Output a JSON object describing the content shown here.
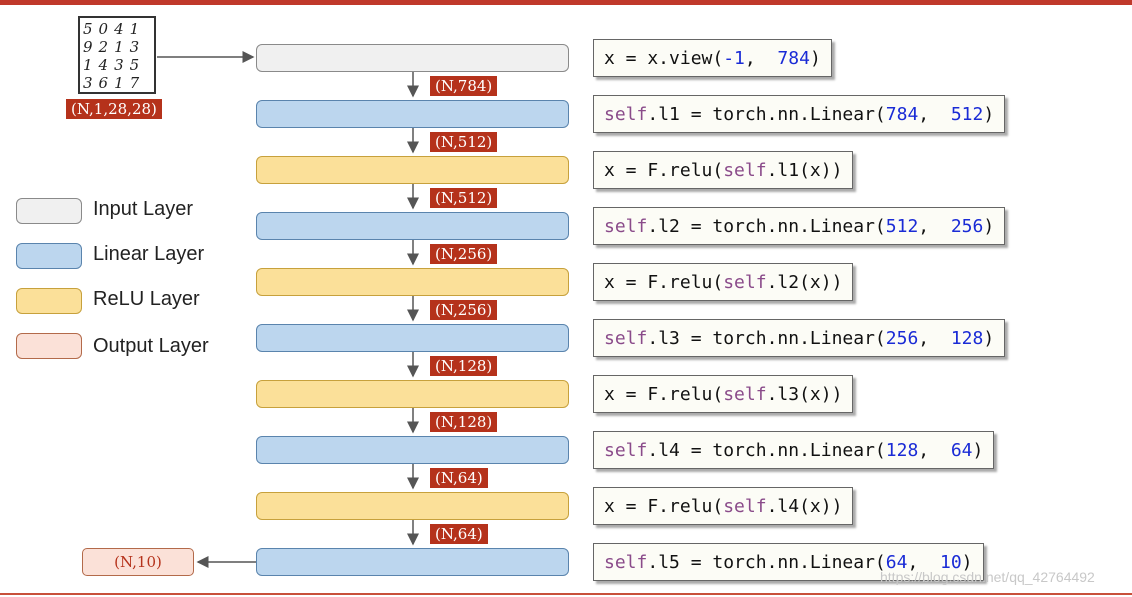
{
  "mnist": {
    "rows": [
      "5041",
      "9213",
      "1435",
      "3617"
    ]
  },
  "input_shape": "(N,1,28,28)",
  "shapes": [
    "(N,784)",
    "(N,512)",
    "(N,512)",
    "(N,256)",
    "(N,256)",
    "(N,128)",
    "(N,128)",
    "(N,64)",
    "(N,64)"
  ],
  "output_shape": "(N,10)",
  "code_lines": [
    [
      {
        "t": "x = x.view("
      },
      {
        "t": "-1",
        "c": "num"
      },
      {
        "t": ",  "
      },
      {
        "t": "784",
        "c": "num"
      },
      {
        "t": ")"
      }
    ],
    [
      {
        "t": "self",
        "c": "kw"
      },
      {
        "t": ".l1 = torch.nn.Linear("
      },
      {
        "t": "784",
        "c": "num"
      },
      {
        "t": ",  "
      },
      {
        "t": "512",
        "c": "num"
      },
      {
        "t": ")"
      }
    ],
    [
      {
        "t": "x = F.relu("
      },
      {
        "t": "self",
        "c": "kw"
      },
      {
        "t": ".l1(x))"
      }
    ],
    [
      {
        "t": "self",
        "c": "kw"
      },
      {
        "t": ".l2 = torch.nn.Linear("
      },
      {
        "t": "512",
        "c": "num"
      },
      {
        "t": ",  "
      },
      {
        "t": "256",
        "c": "num"
      },
      {
        "t": ")"
      }
    ],
    [
      {
        "t": "x = F.relu("
      },
      {
        "t": "self",
        "c": "kw"
      },
      {
        "t": ".l2(x))"
      }
    ],
    [
      {
        "t": "self",
        "c": "kw"
      },
      {
        "t": ".l3 = torch.nn.Linear("
      },
      {
        "t": "256",
        "c": "num"
      },
      {
        "t": ",  "
      },
      {
        "t": "128",
        "c": "num"
      },
      {
        "t": ")"
      }
    ],
    [
      {
        "t": "x = F.relu("
      },
      {
        "t": "self",
        "c": "kw"
      },
      {
        "t": ".l3(x))"
      }
    ],
    [
      {
        "t": "self",
        "c": "kw"
      },
      {
        "t": ".l4 = torch.nn.Linear("
      },
      {
        "t": "128",
        "c": "num"
      },
      {
        "t": ",  "
      },
      {
        "t": "64",
        "c": "num"
      },
      {
        "t": ")"
      }
    ],
    [
      {
        "t": "x = F.relu("
      },
      {
        "t": "self",
        "c": "kw"
      },
      {
        "t": ".l4(x))"
      }
    ],
    [
      {
        "t": "self",
        "c": "kw"
      },
      {
        "t": ".l5 = torch.nn.Linear("
      },
      {
        "t": "64",
        "c": "num"
      },
      {
        "t": ",  "
      },
      {
        "t": "10",
        "c": "num"
      },
      {
        "t": ")"
      }
    ]
  ],
  "legend": [
    {
      "label": "Input Layer",
      "fill": "#f0f0f0",
      "stroke": "#8a8a8a"
    },
    {
      "label": "Linear Layer",
      "fill": "#bcd6ee",
      "stroke": "#5a84ad"
    },
    {
      "label": "ReLU Layer",
      "fill": "#fbe099",
      "stroke": "#c7a13c"
    },
    {
      "label": "Output Layer",
      "fill": "#fbe1d8",
      "stroke": "#b36a4a"
    }
  ],
  "watermark": "https://blog.csdn.net/qq_42764492",
  "colors": {
    "accent": "#b5321b",
    "keyword": "#8a4b8a",
    "number": "#1a2bd6"
  }
}
